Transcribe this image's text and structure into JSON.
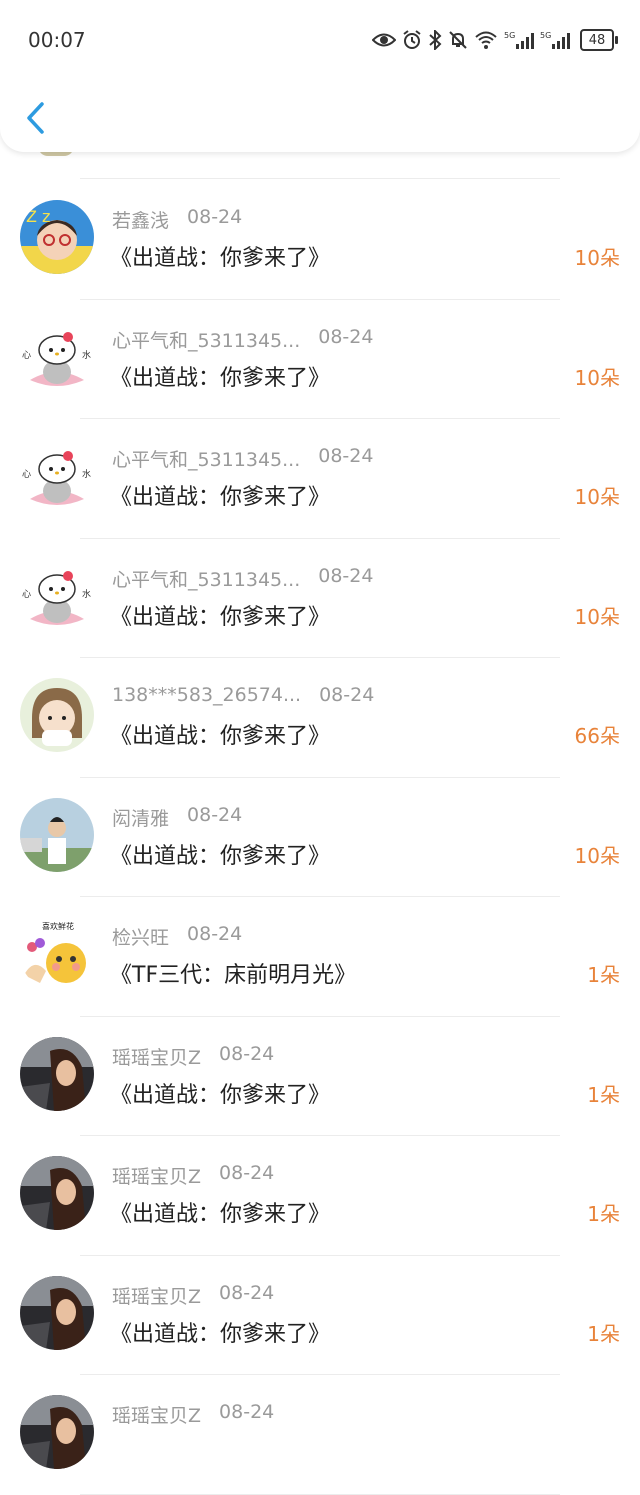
{
  "status_bar": {
    "time": "00:07",
    "battery": "48",
    "icons": [
      "eye-icon",
      "alarm-icon",
      "bluetooth-icon",
      "mute-bell-icon",
      "wifi-icon",
      "signal-5g-icon",
      "signal-5g-icon"
    ]
  },
  "colors": {
    "amount": "#e8833a",
    "back": "#2d9be0",
    "meta": "#9a9a9a"
  },
  "items": [
    {
      "name": "若鑫浅",
      "date": "08-24",
      "title": "《出道战：你爹来了》",
      "amount": "10朵",
      "avatar": "glasses-girl-avatar"
    },
    {
      "name": "心平气和_5311345...",
      "date": "08-24",
      "title": "《出道战：你爹来了》",
      "amount": "10朵",
      "avatar": "hello-kitty-avatar"
    },
    {
      "name": "心平气和_5311345...",
      "date": "08-24",
      "title": "《出道战：你爹来了》",
      "amount": "10朵",
      "avatar": "hello-kitty-avatar"
    },
    {
      "name": "心平气和_5311345...",
      "date": "08-24",
      "title": "《出道战：你爹来了》",
      "amount": "10朵",
      "avatar": "hello-kitty-avatar"
    },
    {
      "name": "138***583_26574...",
      "date": "08-24",
      "title": "《出道战：你爹来了》",
      "amount": "66朵",
      "avatar": "cartoon-girl-avatar"
    },
    {
      "name": "闳清雅",
      "date": "08-24",
      "title": "《出道战：你爹来了》",
      "amount": "10朵",
      "avatar": "photo-person-avatar"
    },
    {
      "name": "检兴旺",
      "date": "08-24",
      "title": "《TF三代：床前明月光》",
      "amount": "1朵",
      "avatar": "emoji-flowers-avatar",
      "avatar_text": "喜欢鲜花"
    },
    {
      "name": "瑶瑶宝贝Z",
      "date": "08-24",
      "title": "《出道战：你爹来了》",
      "amount": "1朵",
      "avatar": "portrait-girl-avatar"
    },
    {
      "name": "瑶瑶宝贝Z",
      "date": "08-24",
      "title": "《出道战：你爹来了》",
      "amount": "1朵",
      "avatar": "portrait-girl-avatar"
    },
    {
      "name": "瑶瑶宝贝Z",
      "date": "08-24",
      "title": "《出道战：你爹来了》",
      "amount": "1朵",
      "avatar": "portrait-girl-avatar"
    },
    {
      "name": "瑶瑶宝贝Z",
      "date": "08-24",
      "title": "",
      "amount": "",
      "avatar": "portrait-girl-avatar"
    }
  ]
}
